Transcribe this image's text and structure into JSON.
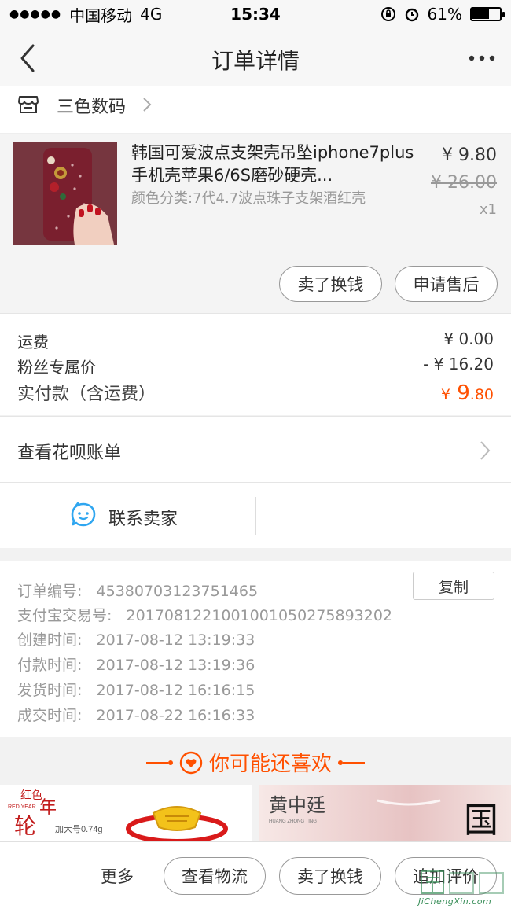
{
  "status_bar": {
    "carrier": "中国移动",
    "network": "4G",
    "time": "15:34",
    "battery": "61%",
    "battery_level": 0.61
  },
  "nav": {
    "title": "订单详情",
    "back_icon": "chevron-left-icon",
    "more_icon": "more-dots-icon"
  },
  "shop": {
    "name": "三色数码",
    "icon": "store-icon"
  },
  "product": {
    "title": "韩国可爱波点支架壳吊坠iphone7plus手机壳苹果6/6S磨砂硬壳...",
    "sku": "颜色分类:7代4.7波点珠子支架酒红壳",
    "price": "¥ 9.80",
    "original_price": "¥ 26.00",
    "quantity": "x1",
    "actions": [
      "卖了换钱",
      "申请售后"
    ]
  },
  "fees": {
    "shipping_label": "运费",
    "shipping_value": "¥ 0.00",
    "fan_price_label": "粉丝专属价",
    "fan_price_value": "- ¥ 16.20",
    "total_label": "实付款（含运费）",
    "total_currency": "¥",
    "total_int": "9",
    "total_dec": ".80"
  },
  "huabei": {
    "label": "查看花呗账单"
  },
  "contact": {
    "label": "联系卖家",
    "icon": "chat-bubble-icon"
  },
  "order_info": {
    "order_no_label": "订单编号:",
    "order_no": "45380703123751465",
    "alipay_label": "支付宝交易号:",
    "alipay_no": "2017081221001001050275893202",
    "created_label": "创建时间:",
    "created": "2017-08-12 13:19:33",
    "paid_label": "付款时间:",
    "paid": "2017-08-12 13:19:36",
    "shipped_label": "发货时间:",
    "shipped": "2017-08-12 16:16:15",
    "completed_label": "成交时间:",
    "completed": "2017-08-22 16:16:33",
    "copy_label": "复制"
  },
  "recommend": {
    "title": "你可能还喜欢",
    "icon": "heart-icon",
    "items": [
      {
        "brand": "红色年轮",
        "brand_en": "RED YEAR",
        "caption": "加大号0.74g"
      },
      {
        "brand": "黄中廷",
        "brand_en": "HUANG ZHONG TING"
      }
    ]
  },
  "bottom_bar": {
    "more": "更多",
    "buttons": [
      "查看物流",
      "卖了换钱",
      "追加评价"
    ]
  },
  "watermark": {
    "text": "JiChengXin.com"
  },
  "colors": {
    "accent": "#ff5000",
    "contact_icon": "#2fa6f0",
    "watermark": "#3a8f5a"
  }
}
